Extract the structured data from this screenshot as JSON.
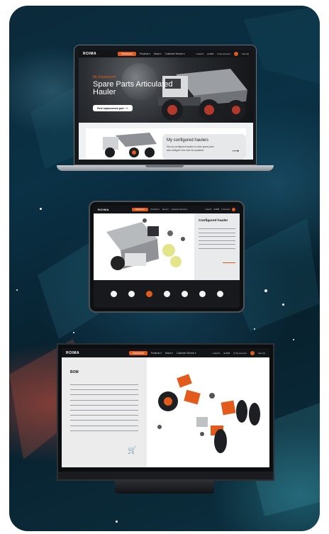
{
  "laptop": {
    "nav": {
      "logo": "ROIMA",
      "items": [
        "Dashboard",
        "Products ▾",
        "About ▾",
        "Customer Service ▾"
      ],
      "right": [
        "⌕ Search",
        "⊞ B2B",
        "⚲ My Account"
      ],
      "cart": "Cart (0)"
    },
    "hero": {
      "kicker": "My Equipment",
      "title": "Spare Parts Articulated Hauler",
      "button": "Find replacement part  ⟶"
    },
    "configured": {
      "title": "My configured haulers",
      "text": "See my configured haulers to order spare parts and configure new ones for quotation",
      "arrow": "⟶"
    }
  },
  "tablet": {
    "nav": {
      "logo": "ROIMA",
      "items": [
        "Dashboard",
        "Products ▾",
        "About ▾",
        "Customer Service ▾"
      ],
      "right": [
        "⌕ Search",
        "⊞ B2B",
        "⚲ Account"
      ]
    },
    "panel_title": "Configured hauler",
    "pager_count": 7,
    "pager_active": 3
  },
  "monitor": {
    "nav": {
      "logo": "ROIMA",
      "items": [
        "Dashboard",
        "Products ▾",
        "About ▾",
        "Customer Service ▾"
      ],
      "right": [
        "⌕ Search",
        "⊞ B2B",
        "⚲ My Account"
      ],
      "cart": "Cart (0)"
    },
    "bom_title": "BOM"
  },
  "colors": {
    "accent": "#e25a1c",
    "dark": "#121417"
  }
}
